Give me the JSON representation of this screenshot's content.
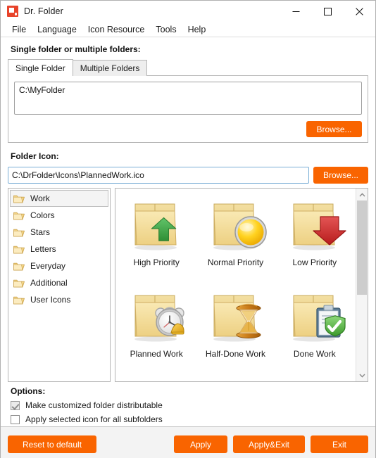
{
  "window": {
    "title": "Dr. Folder",
    "app_icon": "drfolder-logo-icon",
    "minimize_label": "—",
    "maximize_label": "□",
    "close_label": "✕"
  },
  "menubar": {
    "items": [
      {
        "label": "File"
      },
      {
        "label": "Language"
      },
      {
        "label": "Icon Resource"
      },
      {
        "label": "Tools"
      },
      {
        "label": "Help"
      }
    ]
  },
  "folder_section": {
    "label": "Single folder or multiple folders:",
    "tabs": [
      {
        "label": "Single Folder",
        "active": true
      },
      {
        "label": "Multiple Folders",
        "active": false
      }
    ],
    "path_value": "C:\\MyFolder",
    "path_placeholder": "",
    "browse_label": "Browse..."
  },
  "icon_section": {
    "label": "Folder Icon:",
    "path_value": "C:\\DrFolder\\Icons\\PlannedWork.ico",
    "path_placeholder": "",
    "browse_label": "Browse..."
  },
  "categories": [
    {
      "label": "Work",
      "icon": "folder-icon",
      "selected": true
    },
    {
      "label": "Colors",
      "icon": "folder-icon",
      "selected": false
    },
    {
      "label": "Stars",
      "icon": "folder-icon",
      "selected": false
    },
    {
      "label": "Letters",
      "icon": "folder-icon",
      "selected": false
    },
    {
      "label": "Everyday",
      "icon": "folder-icon",
      "selected": false
    },
    {
      "label": "Additional",
      "icon": "folder-icon",
      "selected": false
    },
    {
      "label": "User Icons",
      "icon": "folder-icon",
      "selected": false
    }
  ],
  "icons": [
    {
      "label": "High Priority",
      "badge": "green-up-arrow-icon"
    },
    {
      "label": "Normal Priority",
      "badge": "yellow-sphere-icon"
    },
    {
      "label": "Low Priority",
      "badge": "red-down-arrow-icon"
    },
    {
      "label": "Planned Work",
      "badge": "alarm-clock-icon"
    },
    {
      "label": "Half-Done Work",
      "badge": "hourglass-icon"
    },
    {
      "label": "Done Work",
      "badge": "clipboard-check-icon"
    }
  ],
  "scrollbar": {
    "up_arrow": "chevron-up-icon",
    "down_arrow": "chevron-down-icon",
    "thumb_position_percent": 0,
    "thumb_size_percent": 56
  },
  "options": {
    "title": "Options:",
    "checkboxes": [
      {
        "label": "Make customized folder distributable",
        "checked": true
      },
      {
        "label": "Apply selected icon for all subfolders",
        "checked": false
      }
    ]
  },
  "footer": {
    "reset_label": "Reset to default",
    "apply_label": "Apply",
    "apply_exit_label": "Apply&Exit",
    "exit_label": "Exit"
  },
  "colors": {
    "accent_orange": "#f96400",
    "logo_red": "#e8432a",
    "folder_yellow": "#f5d98a",
    "arrow_green": "#3e9e3e",
    "arrow_red": "#d12c2c",
    "sphere_yellow": "#ffc800",
    "shield_green": "#4fae3c"
  }
}
